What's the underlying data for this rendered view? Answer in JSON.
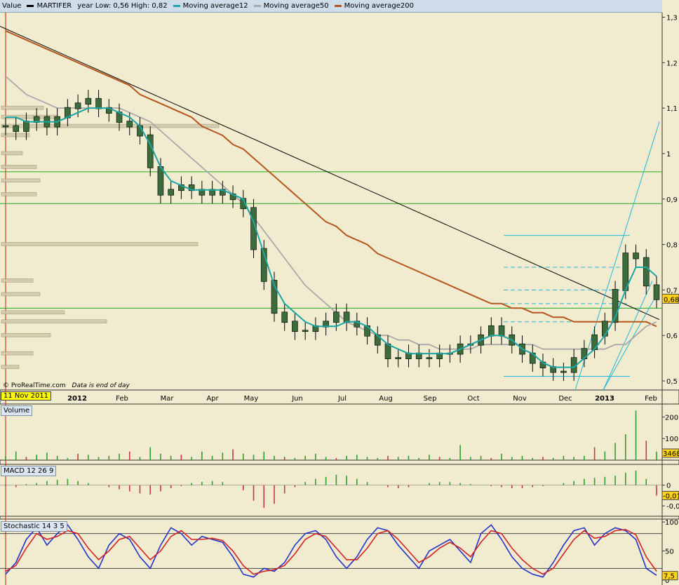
{
  "legend": {
    "value_label": "Value",
    "items": [
      {
        "label": "MARTIFER",
        "color": "#000000"
      },
      {
        "label": "year Low: 0,56 High: 0,82",
        "color": ""
      },
      {
        "label": "Moving average12",
        "color": "#1aa6a6"
      },
      {
        "label": "Moving average50",
        "color": "#a9a9a9"
      },
      {
        "label": "Moving average200",
        "color": "#b5561b"
      }
    ]
  },
  "footer": {
    "credit": "© ProRealTime.com",
    "note": "Data is end of day"
  },
  "cursor_date": "11 Nov 2011",
  "colors": {
    "background": "#f1ecd0",
    "ma12": "#1aa6a6",
    "ma50": "#a9a9a9",
    "ma200": "#b5561b",
    "support": "#22aa22",
    "volume": "#2e9e2e",
    "volume_down": "#c43b3b",
    "stoch_k": "#2233cc",
    "stoch_d": "#d42222",
    "cursor": "#d23b1f"
  },
  "chart_data": [
    {
      "type": "bar",
      "name": "price",
      "ylim": [
        0.48,
        1.31
      ],
      "y_ticks": [
        "1,3",
        "1,2",
        "1,1",
        "1",
        "0,9",
        "0,8",
        "0,7",
        "0,6",
        "0,5"
      ],
      "y_tick_values": [
        1.3,
        1.2,
        1.1,
        1.0,
        0.9,
        0.8,
        0.7,
        0.6,
        0.5
      ],
      "last_value_label": "0,68",
      "x_ticks": [
        "2012",
        "Feb",
        "Mar",
        "Apr",
        "May",
        "Jun",
        "Jul",
        "Aug",
        "Sep",
        "Oct",
        "Nov",
        "Dec",
        "2013",
        "Feb"
      ],
      "support_lines": [
        0.96,
        0.89,
        0.66
      ],
      "trendline": [
        [
          0,
          1.27
        ],
        [
          300,
          0.63
        ]
      ],
      "fib_levels": [
        0.82,
        0.75,
        0.7,
        0.67,
        0.63,
        0.51
      ],
      "closes_weekly": [
        1.06,
        1.05,
        1.07,
        1.08,
        1.06,
        1.08,
        1.1,
        1.11,
        1.12,
        1.1,
        1.09,
        1.07,
        1.06,
        1.04,
        0.97,
        0.91,
        0.92,
        0.93,
        0.92,
        0.91,
        0.92,
        0.91,
        0.9,
        0.88,
        0.79,
        0.72,
        0.65,
        0.63,
        0.61,
        0.61,
        0.62,
        0.63,
        0.65,
        0.63,
        0.62,
        0.6,
        0.58,
        0.55,
        0.55,
        0.56,
        0.55,
        0.55,
        0.56,
        0.56,
        0.58,
        0.58,
        0.6,
        0.62,
        0.6,
        0.58,
        0.56,
        0.54,
        0.53,
        0.52,
        0.52,
        0.55,
        0.57,
        0.6,
        0.63,
        0.7,
        0.78,
        0.77,
        0.71,
        0.68
      ],
      "ma12": [
        1.08,
        1.08,
        1.07,
        1.07,
        1.07,
        1.07,
        1.08,
        1.09,
        1.1,
        1.1,
        1.1,
        1.09,
        1.08,
        1.06,
        1.02,
        0.97,
        0.94,
        0.93,
        0.92,
        0.92,
        0.92,
        0.92,
        0.91,
        0.9,
        0.85,
        0.78,
        0.71,
        0.67,
        0.65,
        0.63,
        0.62,
        0.62,
        0.62,
        0.63,
        0.63,
        0.62,
        0.6,
        0.58,
        0.57,
        0.56,
        0.56,
        0.56,
        0.56,
        0.56,
        0.57,
        0.58,
        0.59,
        0.6,
        0.6,
        0.59,
        0.57,
        0.56,
        0.54,
        0.53,
        0.53,
        0.53,
        0.55,
        0.57,
        0.6,
        0.64,
        0.7,
        0.75,
        0.75,
        0.73
      ],
      "ma50": [
        1.17,
        1.15,
        1.13,
        1.12,
        1.11,
        1.1,
        1.1,
        1.1,
        1.1,
        1.1,
        1.1,
        1.1,
        1.09,
        1.08,
        1.07,
        1.05,
        1.03,
        1.01,
        0.99,
        0.97,
        0.95,
        0.93,
        0.91,
        0.89,
        0.86,
        0.83,
        0.8,
        0.77,
        0.74,
        0.71,
        0.69,
        0.67,
        0.65,
        0.63,
        0.62,
        0.61,
        0.6,
        0.6,
        0.59,
        0.59,
        0.58,
        0.58,
        0.57,
        0.57,
        0.57,
        0.57,
        0.58,
        0.58,
        0.58,
        0.58,
        0.58,
        0.58,
        0.57,
        0.57,
        0.57,
        0.57,
        0.57,
        0.57,
        0.57,
        0.58,
        0.58,
        0.6,
        0.62,
        0.63
      ],
      "ma200": [
        1.27,
        1.26,
        1.25,
        1.24,
        1.23,
        1.22,
        1.21,
        1.2,
        1.19,
        1.18,
        1.17,
        1.16,
        1.15,
        1.13,
        1.12,
        1.11,
        1.1,
        1.09,
        1.08,
        1.06,
        1.05,
        1.04,
        1.02,
        1.01,
        0.99,
        0.97,
        0.95,
        0.93,
        0.91,
        0.89,
        0.87,
        0.85,
        0.84,
        0.82,
        0.81,
        0.8,
        0.78,
        0.77,
        0.76,
        0.75,
        0.74,
        0.73,
        0.72,
        0.71,
        0.7,
        0.69,
        0.68,
        0.67,
        0.67,
        0.66,
        0.66,
        0.65,
        0.65,
        0.64,
        0.64,
        0.63,
        0.63,
        0.63,
        0.63,
        0.63,
        0.63,
        0.63,
        0.63,
        0.62
      ]
    },
    {
      "type": "bar",
      "name": "volume",
      "title": "Volume",
      "y_ticks": [
        "200K",
        "100K"
      ],
      "y_tick_values": [
        200000,
        100000
      ],
      "ylim": [
        0,
        260000
      ],
      "last_value_label": "3468",
      "values_weekly": [
        20000,
        40000,
        15000,
        25000,
        35000,
        20000,
        10000,
        30000,
        25000,
        15000,
        20000,
        30000,
        40000,
        15000,
        60000,
        30000,
        20000,
        25000,
        15000,
        40000,
        20000,
        35000,
        50000,
        30000,
        25000,
        40000,
        20000,
        15000,
        10000,
        20000,
        30000,
        15000,
        10000,
        20000,
        25000,
        15000,
        10000,
        20000,
        15000,
        20000,
        10000,
        25000,
        15000,
        10000,
        70000,
        15000,
        20000,
        10000,
        30000,
        15000,
        20000,
        10000,
        15000,
        10000,
        20000,
        15000,
        20000,
        60000,
        40000,
        80000,
        120000,
        230000,
        90000,
        40000
      ]
    },
    {
      "type": "bar",
      "name": "macd",
      "title": "MACD 12 26 9",
      "y_ticks": [
        "0",
        "-0,02"
      ],
      "y_tick_values": [
        0,
        -0.02
      ],
      "ylim": [
        -0.03,
        0.02
      ],
      "last_value_label": "-0,01",
      "values_weekly": [
        -0.001,
        -0.002,
        0.001,
        0.002,
        0.004,
        0.005,
        0.006,
        0.004,
        0.002,
        0.0,
        -0.002,
        -0.004,
        -0.006,
        -0.008,
        -0.009,
        -0.006,
        -0.003,
        -0.001,
        0.002,
        0.003,
        0.004,
        0.003,
        0.0,
        -0.005,
        -0.015,
        -0.022,
        -0.018,
        -0.008,
        -0.002,
        0.003,
        0.006,
        0.008,
        0.01,
        0.009,
        0.006,
        0.003,
        0.0,
        -0.002,
        -0.003,
        -0.002,
        0.0,
        0.002,
        0.003,
        0.003,
        0.002,
        0.001,
        0.0,
        -0.001,
        -0.002,
        -0.003,
        -0.003,
        -0.002,
        -0.001,
        0.0,
        0.002,
        0.004,
        0.006,
        0.007,
        0.008,
        0.009,
        0.012,
        0.014,
        0.006,
        -0.01
      ]
    },
    {
      "type": "line",
      "name": "stochastic",
      "title": "Stochastic 14 3 5",
      "y_ticks": [
        "100",
        "50",
        "0"
      ],
      "y_tick_values": [
        100,
        50,
        0
      ],
      "ylim": [
        -5,
        105
      ],
      "last_value_label": "7,5",
      "series": [
        {
          "name": "%K",
          "values": [
            10,
            30,
            70,
            90,
            60,
            80,
            95,
            70,
            40,
            20,
            60,
            80,
            70,
            40,
            20,
            60,
            90,
            80,
            60,
            75,
            70,
            65,
            40,
            10,
            5,
            20,
            15,
            30,
            60,
            80,
            85,
            70,
            40,
            20,
            40,
            70,
            90,
            85,
            60,
            40,
            20,
            50,
            60,
            70,
            50,
            30,
            80,
            95,
            70,
            40,
            20,
            10,
            5,
            30,
            60,
            85,
            90,
            60,
            80,
            90,
            85,
            70,
            20,
            8
          ]
        },
        {
          "name": "%D",
          "values": [
            15,
            25,
            55,
            80,
            70,
            75,
            85,
            80,
            55,
            35,
            50,
            70,
            75,
            55,
            35,
            50,
            75,
            85,
            70,
            70,
            72,
            68,
            50,
            25,
            10,
            15,
            18,
            25,
            45,
            70,
            80,
            75,
            55,
            35,
            35,
            55,
            80,
            85,
            70,
            50,
            30,
            40,
            55,
            65,
            55,
            40,
            65,
            85,
            80,
            55,
            35,
            20,
            10,
            20,
            45,
            70,
            85,
            72,
            75,
            85,
            87,
            78,
            40,
            15
          ]
        }
      ]
    }
  ]
}
